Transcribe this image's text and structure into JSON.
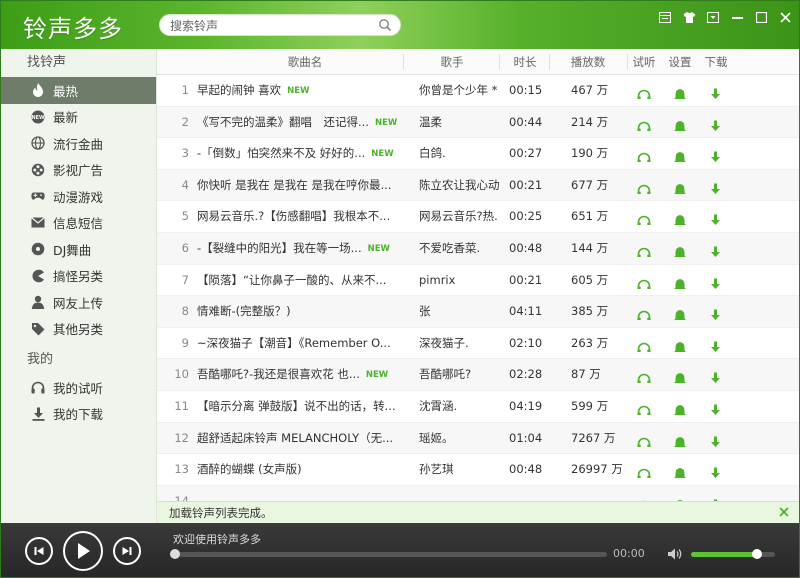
{
  "app": {
    "title": "铃声多多"
  },
  "search": {
    "placeholder": "搜索铃声"
  },
  "sidebar": {
    "section_find": "找铃声",
    "items": [
      {
        "label": "最热",
        "icon": "flame-icon",
        "active": true
      },
      {
        "label": "最新",
        "icon": "new-badge-icon"
      },
      {
        "label": "流行金曲",
        "icon": "globe-icon"
      },
      {
        "label": "影视广告",
        "icon": "film-reel-icon"
      },
      {
        "label": "动漫游戏",
        "icon": "gamepad-icon"
      },
      {
        "label": "信息短信",
        "icon": "envelope-icon"
      },
      {
        "label": "DJ舞曲",
        "icon": "disc-icon"
      },
      {
        "label": "搞怪另类",
        "icon": "pacman-icon"
      },
      {
        "label": "网友上传",
        "icon": "user-icon"
      },
      {
        "label": "其他另类",
        "icon": "tag-icon"
      }
    ],
    "section_mine": "我的",
    "mine_items": [
      {
        "label": "我的试听",
        "icon": "headphones-icon"
      },
      {
        "label": "我的下载",
        "icon": "download-icon"
      }
    ]
  },
  "table": {
    "headers": {
      "title": "歌曲名",
      "artist": "歌手",
      "duration": "时长",
      "plays": "播放数",
      "listen": "试听",
      "set": "设置",
      "download": "下载"
    },
    "new_tag": "NEW",
    "rows": [
      {
        "num": "1",
        "title": "早起的闹钟 喜欢",
        "is_new": true,
        "artist": "你曾是个少年 *",
        "duration": "00:15",
        "plays": "467 万"
      },
      {
        "num": "2",
        "title": "《写不完的温柔》翻唱　还记得...",
        "is_new": true,
        "artist": "温柔",
        "duration": "00:44",
        "plays": "214 万"
      },
      {
        "num": "3",
        "title": "-「倒数」怕突然来不及 好好的...",
        "is_new": true,
        "artist": "白鸽.",
        "duration": "00:27",
        "plays": "190 万"
      },
      {
        "num": "4",
        "title": "你快听 是我在 是我在 是我在哼你最...",
        "is_new": false,
        "artist": "陈立农让我心动.",
        "duration": "00:21",
        "plays": "677 万"
      },
      {
        "num": "5",
        "title": "网易云音乐.?【伤感翻唱】我根本不...",
        "is_new": false,
        "artist": "网易云音乐?热...",
        "duration": "00:25",
        "plays": "651 万"
      },
      {
        "num": "6",
        "title": "-【裂缝中的阳光】我在等一场...",
        "is_new": true,
        "artist": "不爱吃香菜.",
        "duration": "00:48",
        "plays": "144 万"
      },
      {
        "num": "7",
        "title": "【陨落】“让你鼻子一酸的、从来不...",
        "is_new": false,
        "artist": "pimrix",
        "duration": "00:21",
        "plays": "605 万"
      },
      {
        "num": "8",
        "title": "情难断-(完整版？)",
        "is_new": false,
        "artist": "张",
        "duration": "04:11",
        "plays": "385 万"
      },
      {
        "num": "9",
        "title": "~深夜猫子【潮音】《Remember O...",
        "is_new": false,
        "artist": "深夜猫子.",
        "duration": "02:10",
        "plays": "263 万"
      },
      {
        "num": "10",
        "title": "吾酷哪吒?-我还是很喜欢花 也...",
        "is_new": true,
        "artist": "吾酷哪吒?",
        "duration": "02:28",
        "plays": "87 万"
      },
      {
        "num": "11",
        "title": "【暗示分离 弹鼓版】说不出的话，转...",
        "is_new": false,
        "artist": "沈霄涵.",
        "duration": "04:19",
        "plays": "599 万"
      },
      {
        "num": "12",
        "title": "超舒适起床铃声 MELANCHOLY（无...",
        "is_new": false,
        "artist": "瑶姬。",
        "duration": "01:04",
        "plays": "7267 万"
      },
      {
        "num": "13",
        "title": "酒醉的蝴蝶 (女声版)",
        "is_new": false,
        "artist": "孙艺琪",
        "duration": "00:48",
        "plays": "26997 万"
      },
      {
        "num": "14",
        "title": "",
        "is_new": false,
        "artist": "",
        "duration": "",
        "plays": ""
      }
    ]
  },
  "status": {
    "text": "加载铃声列表完成。"
  },
  "player": {
    "now_playing": "欢迎使用铃声多多",
    "time": "00:00",
    "progress": 0.0,
    "volume": 0.78
  },
  "colors": {
    "brand_green": "#4bb22a",
    "active_item": "#6f7c69"
  }
}
